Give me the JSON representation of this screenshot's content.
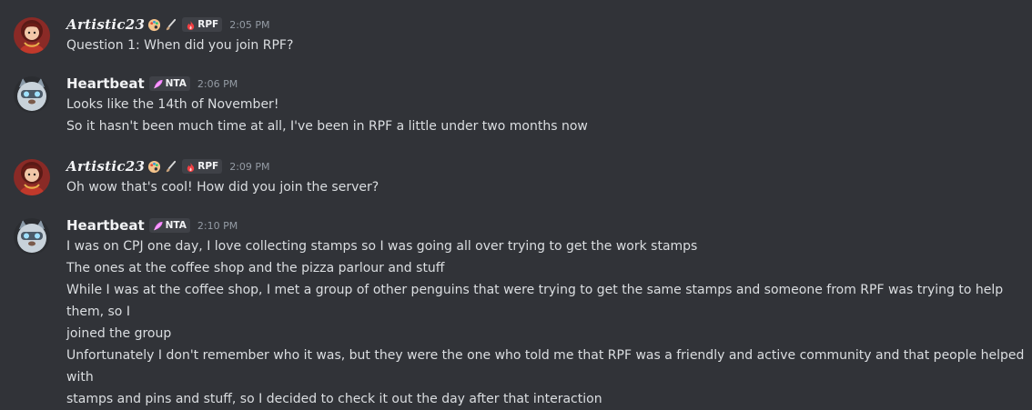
{
  "messages": [
    {
      "author": "Artistic23",
      "tag": "RPF",
      "time": "2:05 PM",
      "lines": [
        "Question 1: When did you join RPF?"
      ]
    },
    {
      "author": "Heartbeat",
      "tag": "NTA",
      "time": "2:06 PM",
      "lines": [
        "Looks like the 14th of November!",
        "So it hasn't been much time at all, I've been in RPF a little under two months now"
      ]
    },
    {
      "author": "Artistic23",
      "tag": "RPF",
      "time": "2:09 PM",
      "lines": [
        "Oh wow that's cool! How did you join the server?"
      ]
    },
    {
      "author": "Heartbeat",
      "tag": "NTA",
      "time": "2:10 PM",
      "lines": [
        "I was on CPJ one day, I love collecting stamps so I was going all over trying to get the work stamps",
        "The ones at the coffee shop and the pizza parlour and stuff",
        "While I was at the coffee shop, I met a group of other penguins that were trying to get the same stamps and someone from RPF was trying to help them, so I",
        "joined the group",
        "Unfortunately I don't remember who it was, but they were the one who told me that RPF was a friendly and active community and that people helped with",
        "stamps and pins and stuff, so I decided to check it out the day after that interaction"
      ]
    }
  ],
  "icons": {
    "artistic_emojis": [
      "palette-icon",
      "paintbrush-icon"
    ],
    "rpf_tag_icon": "flame-icon",
    "nta_tag_icon": "feather-icon"
  },
  "colors": {
    "background": "#313338",
    "username": "#f2f3f5",
    "message_text": "#dbdee1",
    "timestamp": "#949ba4",
    "tag_background": "#3f4147",
    "rpf_icon": "#f23f43",
    "nta_icon": "#f47fff"
  }
}
